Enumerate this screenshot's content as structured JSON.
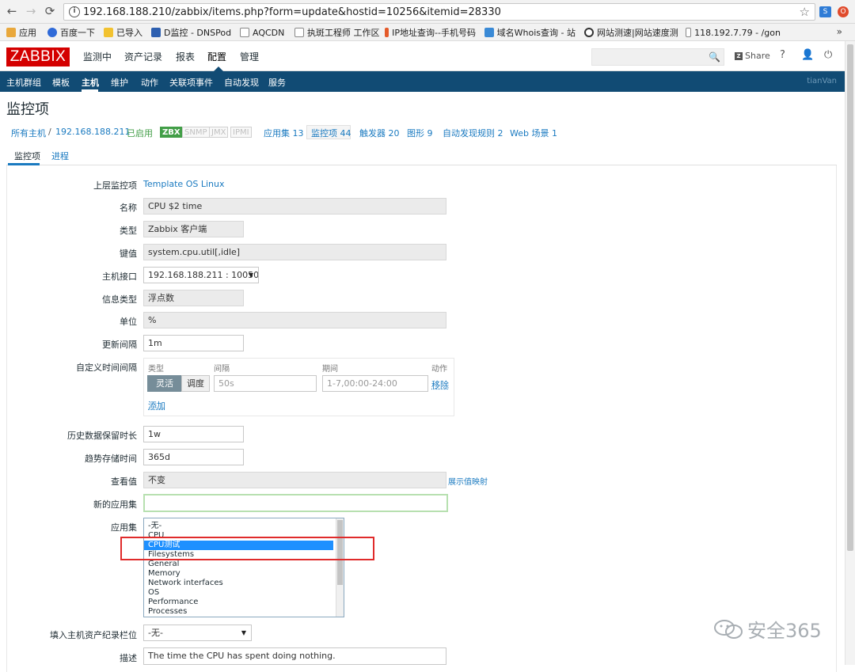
{
  "browser": {
    "url": "192.168.188.210/zabbix/items.php?form=update&hostid=10256&itemid=28330",
    "bookmarks": [
      "应用",
      "百度一下",
      "已导入",
      "D监控 - DNSPod",
      "AQCDN",
      "执斑工程师 工作区",
      "IP地址查询--手机号码",
      "域名Whois查询 - 站",
      "网站测速|网站速度测",
      "118.192.7.79 - /gon"
    ]
  },
  "header": {
    "logo": "ZABBIX",
    "menu": [
      "监测中",
      "资产记录",
      "报表",
      "配置",
      "管理"
    ],
    "share": "Share",
    "help": "?"
  },
  "submenu": {
    "items": [
      "主机群组",
      "模板",
      "主机",
      "维护",
      "动作",
      "关联项事件",
      "自动发现",
      "服务"
    ],
    "user": "tianVan"
  },
  "page": {
    "title": "监控项",
    "breadcrumb": {
      "all_hosts": "所有主机",
      "sep": "/",
      "host": "192.168.188.211",
      "status": "已启用",
      "tags": [
        "ZBX",
        "SNMP",
        "JMX",
        "IPMI"
      ],
      "apps": "应用集 13",
      "items": "监控项 44",
      "triggers": "触发器 20",
      "graphs": "图形 9",
      "discovery": "自动发现规则 2",
      "web": "Web 场景 1"
    },
    "tabs": [
      "监控项",
      "进程"
    ]
  },
  "form": {
    "parent_label": "上层监控项",
    "parent_value": "Template OS Linux",
    "name_label": "名称",
    "name_value": "CPU $2 time",
    "type_label": "类型",
    "type_value": "Zabbix 客户端",
    "key_label": "键值",
    "key_value": "system.cpu.util[,idle]",
    "interface_label": "主机接口",
    "interface_value": "192.168.188.211 : 10050",
    "info_type_label": "信息类型",
    "info_type_value": "浮点数",
    "units_label": "单位",
    "units_value": "%",
    "interval_label": "更新间隔",
    "interval_value": "1m",
    "custom_label": "自定义时间间隔",
    "custom": {
      "col_type": "类型",
      "col_interval": "间隔",
      "col_period": "期间",
      "col_action": "动作",
      "flexible": "灵活",
      "scheduling": "调度",
      "interval_placeholder": "50s",
      "period_placeholder": "1-7,00:00-24:00",
      "remove": "移除",
      "add": "添加"
    },
    "history_label": "历史数据保留时长",
    "history_value": "1w",
    "trends_label": "趋势存储时间",
    "trends_value": "365d",
    "valuemap_label": "查看值",
    "valuemap_value": "不变",
    "valuemap_link": "展示值映射",
    "newapp_label": "新的应用集",
    "newapp_value": "",
    "apps_label": "应用集",
    "apps_options": [
      "-无-",
      "CPU",
      "CPU测试",
      "Filesystems",
      "General",
      "Memory",
      "Network interfaces",
      "OS",
      "Performance",
      "Processes"
    ],
    "apps_selected": "CPU测试",
    "inventory_label": "填入主机资产纪录栏位",
    "inventory_value": "-无-",
    "desc_label": "描述",
    "desc_value": "The time the CPU has spent doing nothing."
  },
  "watermark": "安全365"
}
